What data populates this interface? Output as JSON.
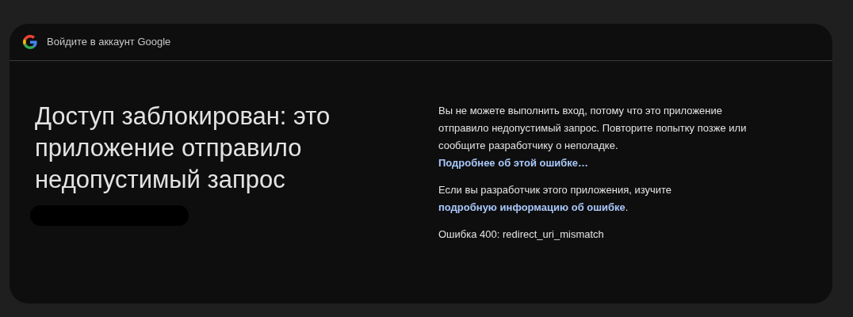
{
  "header": {
    "title": "Войдите в аккаунт Google"
  },
  "heading": "Доступ заблокирован: это приложение отправило недопустимый запрос",
  "paragraphs": [
    {
      "segments": [
        {
          "kind": "text",
          "text": "Вы не можете выполнить вход, потому что это приложение отправило недопустимый запрос. Повторите попытку позже или сообщите разработчику о неполадке. "
        },
        {
          "kind": "link",
          "text": "Подробнее об этой ошибке…"
        }
      ]
    },
    {
      "segments": [
        {
          "kind": "text",
          "text": "Если вы разработчик этого приложения, изучите "
        },
        {
          "kind": "link",
          "text": "подробную информацию об ошибке"
        },
        {
          "kind": "text",
          "text": "."
        }
      ]
    },
    {
      "segments": [
        {
          "kind": "text",
          "text": "Ошибка 400: redirect_uri_mismatch"
        }
      ]
    }
  ]
}
